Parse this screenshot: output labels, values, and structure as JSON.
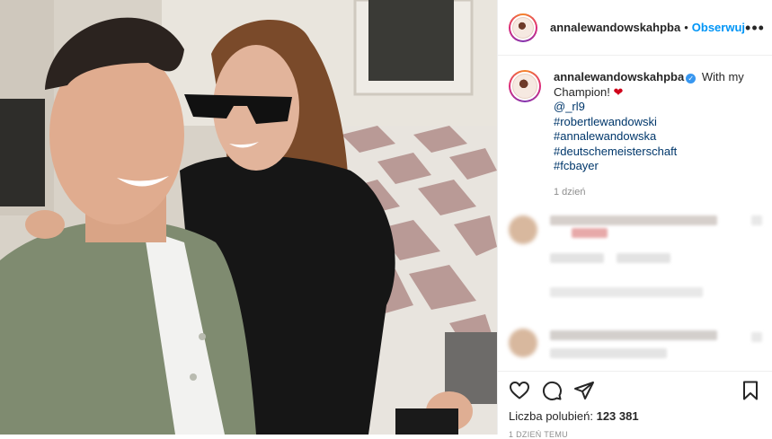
{
  "header": {
    "username": "annalewandowskahpba",
    "separator": "•",
    "follow_label": "Obserwuj",
    "more_label": "•••"
  },
  "caption": {
    "username": "annalewandowskahpba",
    "verified_mark": "✓",
    "text": "With my Champion!",
    "emoji": "❤",
    "mention": "@_rl9",
    "hashtags": [
      "#robertlewandowski",
      "#annalewandowska",
      "#deutschemeisterschaft",
      "#fcbayer"
    ],
    "timestamp": "1 dzień"
  },
  "icons": {
    "like": "heart-icon",
    "comment": "comment-icon",
    "share": "paper-plane-icon",
    "save": "bookmark-icon"
  },
  "likes": {
    "label": "Liczba polubień:",
    "count": "123 381"
  },
  "posted": "1 DZIEŃ TEMU",
  "colors": {
    "accent": "#0095f6",
    "hashtag": "#00376b",
    "heart": "#d0021b",
    "muted": "#8e8e8e"
  }
}
